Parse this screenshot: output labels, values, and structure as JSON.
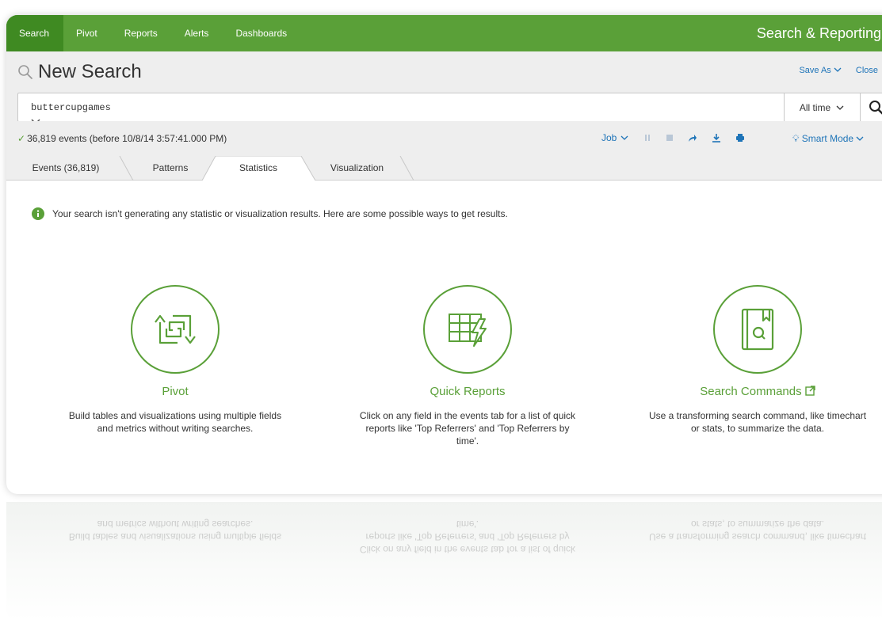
{
  "appbar": {
    "nav": [
      "Search",
      "Pivot",
      "Reports",
      "Alerts",
      "Dashboards"
    ],
    "app_title": "Search & Reporting"
  },
  "header": {
    "page_title": "New Search",
    "save_as": "Save As",
    "close": "Close"
  },
  "search": {
    "query": "buttercupgames",
    "time_range": "All time"
  },
  "status": {
    "text": "36,819 events (before 10/8/14 3:57:41.000 PM)",
    "job_label": "Job",
    "mode": "Smart Mode"
  },
  "tabs": [
    "Events (36,819)",
    "Patterns",
    "Statistics",
    "Visualization"
  ],
  "active_tab": "Statistics",
  "notice": "Your search isn't generating any statistic or visualization results. Here are some possible ways to get results.",
  "options": [
    {
      "title": "Pivot",
      "description": "Build tables and visualizations using multiple fields and metrics without writing searches.",
      "icon": "pivot-icon"
    },
    {
      "title": "Quick Reports",
      "description": "Click on any field in the events tab for a list of quick reports like 'Top Referrers' and 'Top Referrers by time'.",
      "icon": "quick-reports-icon"
    },
    {
      "title": "Search Commands",
      "description": "Use a transforming search command, like timechart or stats, to summarize the data.",
      "icon": "search-commands-icon"
    }
  ],
  "colors": {
    "brand_green": "#5aa038",
    "active_nav_green": "#3f8a22",
    "link_blue": "#1e74b8",
    "header_gray": "#eeeeee"
  },
  "icons": [
    "search-icon",
    "magnifier-icon",
    "check-icon",
    "pause-icon",
    "stop-icon",
    "share-icon",
    "export-icon",
    "print-icon",
    "bulb-icon",
    "info-icon",
    "external-link-icon",
    "chevron-down-icon"
  ]
}
